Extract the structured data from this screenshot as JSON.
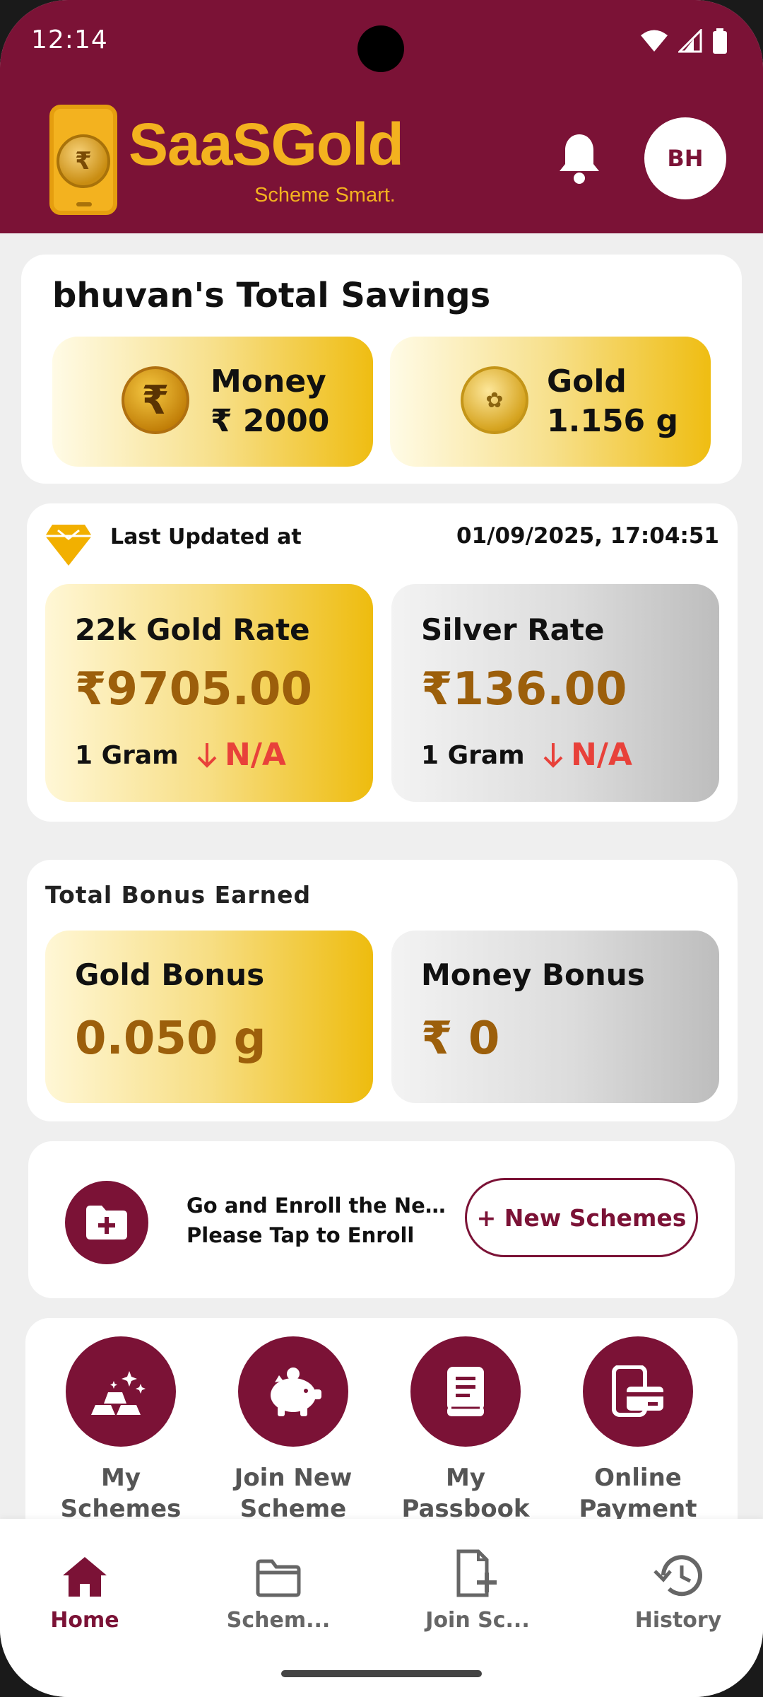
{
  "status_bar": {
    "time": "12:14"
  },
  "header": {
    "app_name": "SaaSGold",
    "tagline": "Scheme Smart.",
    "avatar_initials": "BH",
    "brand_color": "#7b1236",
    "accent_color": "#f3b21f"
  },
  "savings": {
    "title": "bhuvan's Total Savings",
    "money_label": "Money",
    "money_value": "₹ 2000",
    "gold_label": "Gold",
    "gold_value": "1.156 g"
  },
  "rates": {
    "updated_label": "Last Updated at",
    "updated_value": "01/09/2025, 17:04:51",
    "gold_title": "22k Gold Rate",
    "gold_price": "₹9705.00",
    "gold_unit": "1 Gram",
    "gold_change": "N/A",
    "silver_title": "Silver Rate",
    "silver_price": "₹136.00",
    "silver_unit": "1 Gram",
    "silver_change": "N/A"
  },
  "bonus": {
    "heading": "Total Bonus Earned",
    "gold_title": "Gold Bonus",
    "gold_value": "0.050 g",
    "money_title": "Money Bonus",
    "money_value": "₹ 0"
  },
  "enroll": {
    "line1": "Go and Enroll the New ...",
    "line2": "Please Tap to Enroll",
    "button_label": "+ New Schemes"
  },
  "quick_actions": [
    {
      "line1": "My",
      "line2": "Schemes",
      "icon": "gold-bars-icon"
    },
    {
      "line1": "Join New",
      "line2": "Scheme",
      "icon": "piggy-bank-icon"
    },
    {
      "line1": "My",
      "line2": "Passbook",
      "icon": "passbook-icon"
    },
    {
      "line1": "Online",
      "line2": "Payment",
      "icon": "payment-card-icon"
    }
  ],
  "bottom_nav": [
    {
      "label": "Home",
      "icon": "home-icon",
      "active": true
    },
    {
      "label": "Schem...",
      "icon": "folder-icon",
      "active": false
    },
    {
      "label": "Join Sc...",
      "icon": "file-add-icon",
      "active": false
    },
    {
      "label": "History",
      "icon": "history-icon",
      "active": false
    }
  ]
}
